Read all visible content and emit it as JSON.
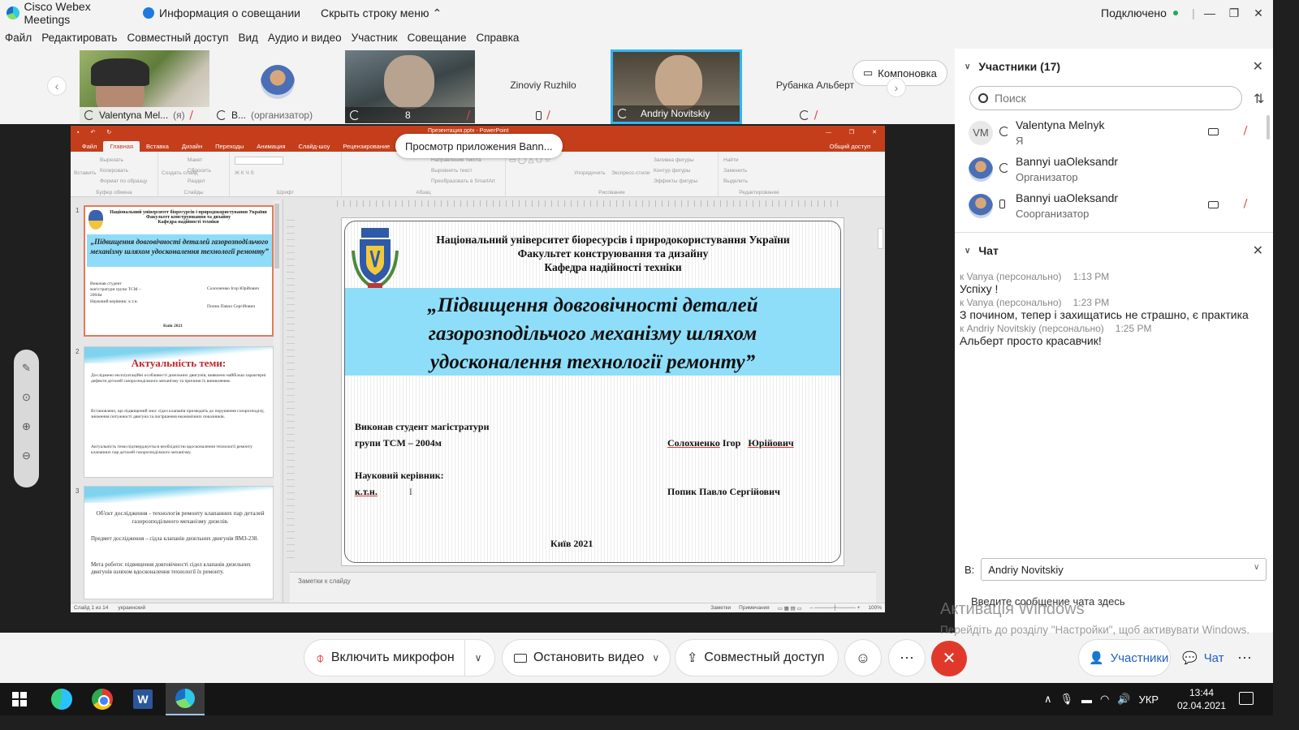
{
  "titlebar": {
    "app_name": "Cisco Webex Meetings",
    "meeting_info": "Информация о совещании",
    "hide_menu": "Скрыть строку меню",
    "status": "Подключено",
    "status_color": "#1aad5b"
  },
  "menu": [
    "Файл",
    "Редактировать",
    "Совместный доступ",
    "Вид",
    "Аудио и видео",
    "Участник",
    "Совещание",
    "Справка"
  ],
  "video_tiles": [
    {
      "name": "Valentyna Mel...",
      "suffix": "(я)"
    },
    {
      "name": "B...",
      "suffix": "(организатор)"
    },
    {
      "name": "8",
      "suffix": ""
    },
    {
      "name": "Zinoviy Ruzhilo",
      "suffix": ""
    },
    {
      "name": "Andriy Novitskiy",
      "suffix": ""
    },
    {
      "name": "Рубанка Альберт",
      "suffix": ""
    }
  ],
  "layout_button": "Компоновка",
  "shared_tooltip": "Просмотр приложения Bann...",
  "ppt": {
    "doc_title": "Презентация.pptx - PowerPoint",
    "tabs": [
      "Файл",
      "Главная",
      "Вставка",
      "Дизайн",
      "Переходы",
      "Анимация",
      "Слайд-шоу",
      "Рецензирование"
    ],
    "share": "Общий доступ",
    "ribbon_groups": [
      "Буфер обмена",
      "Слайды",
      "Шрифт",
      "Абзац",
      "Рисование",
      "Редактирование"
    ],
    "ribbon_items": {
      "paste": "Вставить",
      "cut": "Вырезать",
      "copy": "Копировать",
      "format": "Формат по образцу",
      "create": "Создать слайд",
      "layout": "Макет",
      "reset": "Сбросить",
      "section": "Раздел",
      "text_dir": "Направление текста",
      "align_text": "Выровнять текст",
      "smartart": "Преобразовать в SmartArt",
      "arrange": "Упорядочить",
      "quick_styles": "Экспресс-стили",
      "fill": "Заливка фигуры",
      "outline": "Контур фигуры",
      "effects": "Эффекты фигуры",
      "find": "Найти",
      "replace": "Заменить",
      "select": "Выделить"
    },
    "notes": "Заметки к слайду",
    "status_left": "Слайд 1 из 14",
    "status_lang": "украинский",
    "status_notes": "Заметки",
    "status_comments": "Примечания",
    "zoom": "100%"
  },
  "thumbnails": {
    "t1_uni": "Національний університет біоресурсів і природокористування України",
    "t1_fac": "Факультет конструювання та дизайну",
    "t1_dep": "Кафедра надійності техніки",
    "t1_title": "„Підвищення довговічності деталей газорозподільчого механізму шляхом удосконалення технології ремонту”",
    "t1_student": "Виконав студент магістратури групи ТСМ – 2004м",
    "t1_name": "Солохненко Ігор Юрійович",
    "t1_sup": "Науковий керівник: к.т.н.",
    "t1_supname": "Попик Павло Сергійович",
    "t1_city": "Київ 2021",
    "t2_title": "Актуальність теми:",
    "t2_p1": "Досліджено експлуатаційні особливості дизельних двигунів, виявлено найбільш характерні дефекти деталей газорозподільчого механізму та причини їх виникнення.",
    "t2_p2": "Встановлено, що підвищений знос сідел клапанів призводить до порушення газорозподілу, зниження потужності двигуна та погіршення економічних показників.",
    "t2_p3": "Актуальність теми підтверджується необхідністю вдосконалення технології ремонту клапанних пар деталей газорозподільчого механізму.",
    "t3_object": "Об'єкт дослідження - технологія ремонту клапанних пар деталей газорозподільчого механізму дизелів.",
    "t3_subject": "Предмет дослідження – сідла клапанів дизельних двигунів ЯМЗ-238.",
    "t3_goal": "Мета роботи: підвищення довговічності сідел клапанів дизельних двигунів шляхом вдосконалення технології їх ремонту."
  },
  "slide": {
    "uni": "Національний  університет біоресурсів і природокористування України",
    "faculty": "Факультет конструювання та дизайну",
    "dept": "Кафедра надійності техніки",
    "title_line1": "„Підвищення довговічності деталей",
    "title_line2": "газорозподільчого механізму шляхом",
    "title_line3": "удосконалення технології ремонту”",
    "student_label1": "Виконав студент магістратури",
    "student_label2": "групи ТСМ – 2004м",
    "student_surname": "Солохненко",
    "student_name": "Ігор",
    "student_patronymic": "Юрійович",
    "supervisor_label": "Науковий керівник:",
    "supervisor_degree": "к.т.н.",
    "supervisor_name": "Попик Павло Сергійович",
    "city": "Київ 2021",
    "band_color": "#8fdef9"
  },
  "participants": {
    "header": "Участники (17)",
    "search_placeholder": "Поиск",
    "list": [
      {
        "initials": "VM",
        "name": "Valentyna Melnyk",
        "role": "Я"
      },
      {
        "initials": "",
        "name": "Bannyi uaOleksandr",
        "role": "Организатор"
      },
      {
        "initials": "",
        "name": "Bannyi uaOleksandr",
        "role": "Соорганизатор"
      }
    ]
  },
  "chat": {
    "header": "Чат",
    "messages": [
      {
        "from": "к Vanya (персонально)",
        "time": "1:13 PM",
        "text": "Успіху !"
      },
      {
        "from": "к Vanya (персонально)",
        "time": "1:23 PM",
        "text": "З почином, тепер і захищатись не страшно, є практика"
      },
      {
        "from": "к Andriy Novitskiy (персонально)",
        "time": "1:25 PM",
        "text": "Альберт просто красавчик!"
      }
    ],
    "to_label": "В:",
    "to_value": "Andriy Novitskiy",
    "input_placeholder": "Введите сообщение чата здесь"
  },
  "watermark": {
    "title": "Активація Windows",
    "text": "Перейдіть до розділу \"Настройки\", щоб активувати Windows."
  },
  "controls": {
    "mic": "Включить микрофон",
    "video": "Остановить видео",
    "share": "Совместный доступ",
    "participants": "Участники",
    "chat": "Чат",
    "end_color": "#e0392c"
  },
  "taskbar": {
    "lang": "УКР",
    "time": "13:44",
    "date": "02.04.2021"
  }
}
